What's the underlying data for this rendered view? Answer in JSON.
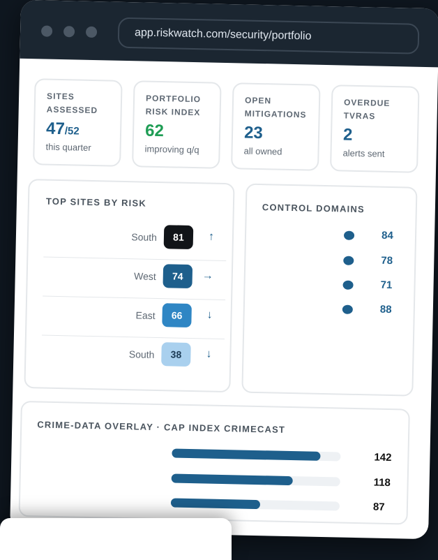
{
  "browser": {
    "url": "app.riskwatch.com/security/portfolio"
  },
  "stats": [
    {
      "label_line1": "SITES",
      "label_line2": "ASSESSED",
      "value": "47",
      "value_suffix": "/52",
      "note": "this quarter",
      "color": "#1e5f8c"
    },
    {
      "label_line1": "PORTFOLIO",
      "label_line2": "RISK INDEX",
      "value": "62",
      "value_suffix": "",
      "note": "improving q/q",
      "color": "#1f9d55"
    },
    {
      "label_line1": "OPEN",
      "label_line2": "MITIGATIONS",
      "value": "23",
      "value_suffix": "",
      "note": "all owned",
      "color": "#1e5f8c"
    },
    {
      "label_line1": "OVERDUE",
      "label_line2": "TVRAS",
      "value": "2",
      "value_suffix": "",
      "note": "alerts sent",
      "color": "#1e5f8c"
    }
  ],
  "top_sites": {
    "title": "TOP SITES BY RISK",
    "rows": [
      {
        "region": "South",
        "score": "81",
        "trend": "↑",
        "color": "#111418"
      },
      {
        "region": "West",
        "score": "74",
        "trend": "→",
        "color": "#1e5f8c"
      },
      {
        "region": "East",
        "score": "66",
        "trend": "↓",
        "color": "#2f86c4"
      },
      {
        "region": "South",
        "score": "38",
        "trend": "↓",
        "color": "#a9d0ee"
      }
    ]
  },
  "control_domains": {
    "title": "CONTROL DOMAINS",
    "rows": [
      {
        "value": "84"
      },
      {
        "value": "78"
      },
      {
        "value": "71"
      },
      {
        "value": "88"
      }
    ]
  },
  "crime_overlay": {
    "title": "CRIME-DATA OVERLAY · CAP INDEX CRIMECAST",
    "rows": [
      {
        "value": "142",
        "fraction": 0.88
      },
      {
        "value": "118",
        "fraction": 0.72
      },
      {
        "value": "87",
        "fraction": 0.53
      }
    ]
  },
  "colors": {
    "accent": "#1e5f8c",
    "positive": "#1f9d55",
    "frame": "#1b2631"
  }
}
